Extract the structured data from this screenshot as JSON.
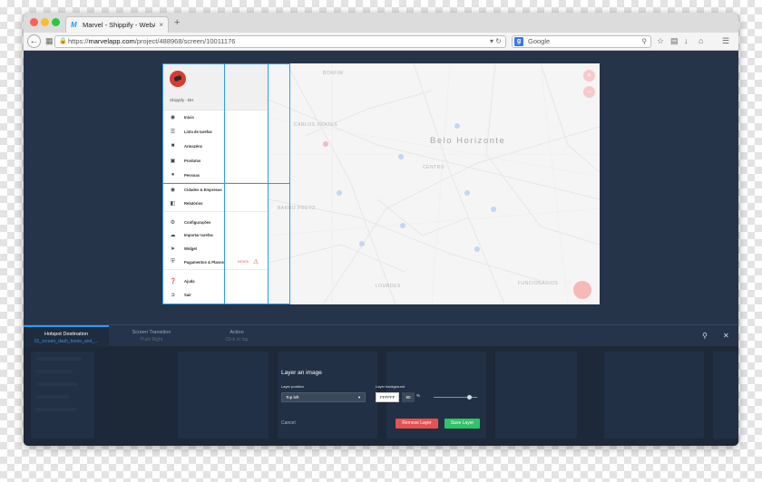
{
  "browser": {
    "tab_title": "Marvel - Shippify - WebApp ...",
    "tab_close": "×",
    "new_tab": "+",
    "url_prefix": "https://",
    "url_domain": "marvelapp.com",
    "url_path": "/project/488968/screen/10011176",
    "search_placeholder": "Google"
  },
  "menu": {
    "brand": "Shippify - BH",
    "items": [
      {
        "label": "Inicio",
        "icon": "speedometer-icon"
      },
      {
        "label": "Lista de tarefas",
        "icon": "list-icon"
      },
      {
        "label": "Armazéns",
        "icon": "warehouse-icon"
      },
      {
        "label": "Produtos",
        "icon": "box-icon"
      },
      {
        "label": "Pessoas",
        "icon": "people-icon"
      },
      {
        "label": "Cidades & Empresas",
        "icon": "globe-icon"
      },
      {
        "label": "Relatórios",
        "icon": "report-icon"
      },
      {
        "label": "Configurações",
        "icon": "gear-icon"
      },
      {
        "label": "Importar tarefas",
        "icon": "cloud-upload-icon"
      },
      {
        "label": "Widget",
        "icon": "rocket-icon"
      },
      {
        "label": "Pagamentos & Planos",
        "icon": "shield-icon",
        "badge": "NOVO!"
      },
      {
        "label": "Ajuda",
        "icon": "help-icon"
      },
      {
        "label": "Sair",
        "icon": "logout-icon"
      }
    ]
  },
  "map": {
    "city": "Belo Horizonte",
    "labels": [
      "CARLOS PRATES",
      "CENTRO",
      "BARRO PRETO",
      "LOURDES",
      "FUNCIONÁRIOS",
      "BONFIM"
    ],
    "zoom_in": "+",
    "zoom_out": "−"
  },
  "panel": {
    "tabs": [
      {
        "title": "Hotspot Destination",
        "subtitle": "01_screen_dash_home_and_..."
      },
      {
        "title": "Screen Transition",
        "subtitle": "Push Right"
      },
      {
        "title": "Action",
        "subtitle": "Click or tap"
      }
    ],
    "dialog": {
      "heading": "Layer an image",
      "position_label": "Layer position",
      "position_value": "Top left",
      "background_label": "Layer background",
      "background_hex": "FFFFFF",
      "opacity_value": "80",
      "percent_symbol": "%",
      "opacity": 0.8,
      "cancel_label": "Cancel",
      "remove_label": "Remove Layer",
      "save_label": "Save Layer"
    }
  },
  "colors": {
    "canvas": "#26344a",
    "hotspot": "#2d9bf0",
    "remove": "#e8514f",
    "save": "#31c36a"
  }
}
